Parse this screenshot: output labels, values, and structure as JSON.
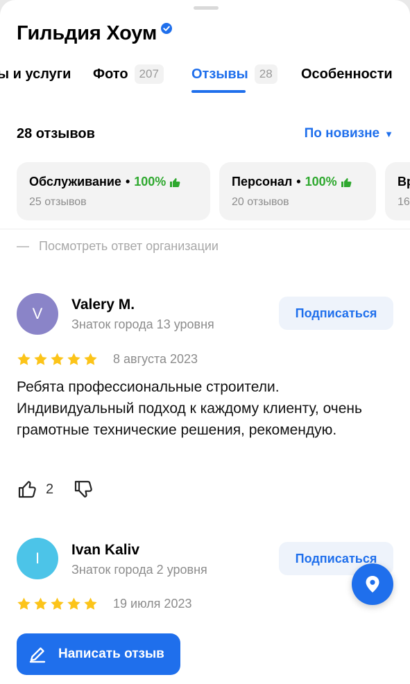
{
  "org": {
    "name": "Гильдия Хоум",
    "verified_icon": "verified-badge-icon"
  },
  "tabs": [
    {
      "label": "ы и услуги",
      "count": ""
    },
    {
      "label": "Фото",
      "count": "207"
    },
    {
      "label": "Отзывы",
      "count": "28",
      "active": true
    },
    {
      "label": "Особенности",
      "count": ""
    }
  ],
  "reviews_header": {
    "total": "28 отзывов",
    "sort_label": "По новизне",
    "sort_caret": "▼"
  },
  "aspects": [
    {
      "name": "Обслуживание",
      "dot": "•",
      "percent": "100%",
      "count": "25 отзывов"
    },
    {
      "name": "Персонал",
      "dot": "•",
      "percent": "100%",
      "count": "20 отзывов"
    },
    {
      "name": "Вр",
      "dot": "",
      "percent": "",
      "count": "16"
    }
  ],
  "org_reply_link": "Посмотреть ответ организации",
  "reviews": [
    {
      "avatar_letter": "V",
      "avatar_color": "#8a84c8",
      "author": "Valery M.",
      "level": "Знаток города 13 уровня",
      "subscribe_label": "Подписаться",
      "rating": 5,
      "date": "8 августа 2023",
      "text": "Ребята профессиональные строители. Индивидуальный подход к каждому клиенту, очень грамотные технические решения, рекомендую.",
      "likes": "2"
    },
    {
      "avatar_letter": "I",
      "avatar_color": "#4cc4e8",
      "author": "Ivan Kaliv",
      "level": "Знаток города 2 уровня",
      "subscribe_label": "Подписаться",
      "rating": 5,
      "date": "19 июля 2023"
    }
  ],
  "write_review_label": "Написать отзыв",
  "colors": {
    "accent": "#1f6fec",
    "positive": "#2ea82e",
    "star": "#fcc419"
  }
}
